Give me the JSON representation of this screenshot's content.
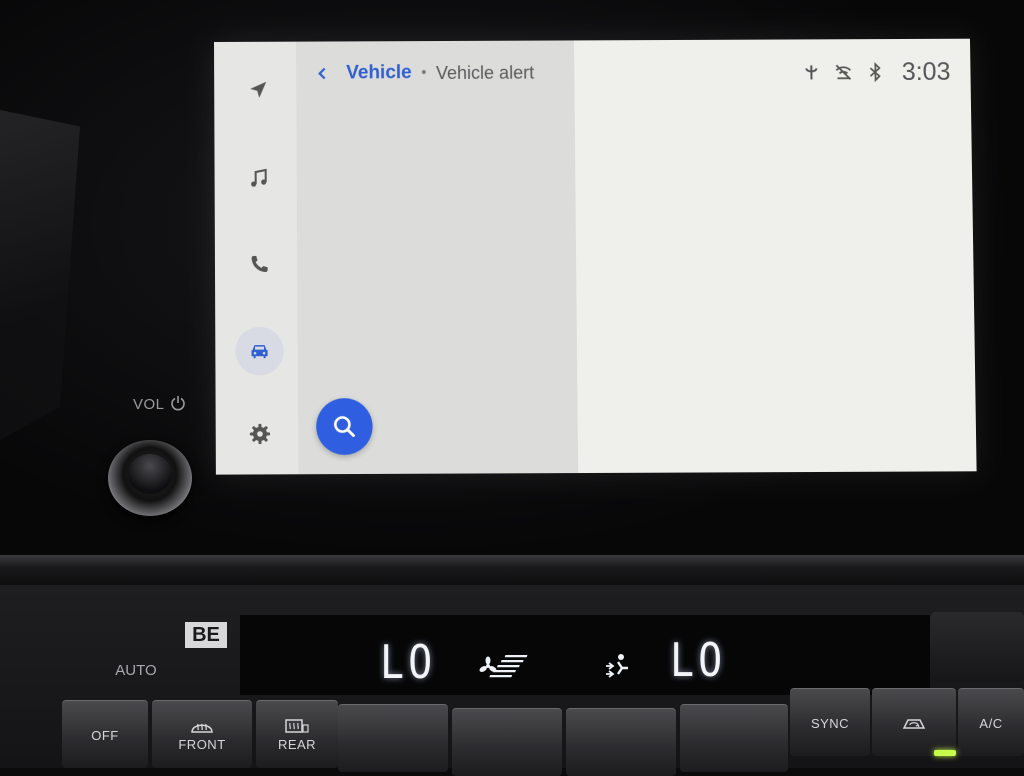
{
  "car": {
    "volume_label": "VOL"
  },
  "screen": {
    "rail": {
      "items": [
        {
          "name": "navigation",
          "icon": "navigation-arrow-icon"
        },
        {
          "name": "music",
          "icon": "music-note-icon"
        },
        {
          "name": "phone",
          "icon": "phone-icon"
        },
        {
          "name": "vehicle",
          "icon": "car-icon",
          "active": true
        },
        {
          "name": "settings",
          "icon": "gear-icon"
        }
      ]
    },
    "header": {
      "parent": "Vehicle",
      "separator": "•",
      "current": "Vehicle alert"
    },
    "status": {
      "time": "3:03",
      "icons": [
        "wireless-charging-icon",
        "no-signal-icon",
        "bluetooth-icon"
      ]
    },
    "search_fab_icon": "search-icon",
    "colors": {
      "accent": "#2f5fe0",
      "list_bg": "#dcdcda",
      "detail_bg": "#efefec"
    }
  },
  "climate": {
    "badge": "BE",
    "auto_label": "AUTO",
    "left_temp": "LO",
    "right_temp": "LO",
    "buttons": {
      "off": "OFF",
      "front": "FRONT",
      "rear": "REAR",
      "sync": "SYNC",
      "ac": "A/C"
    }
  }
}
